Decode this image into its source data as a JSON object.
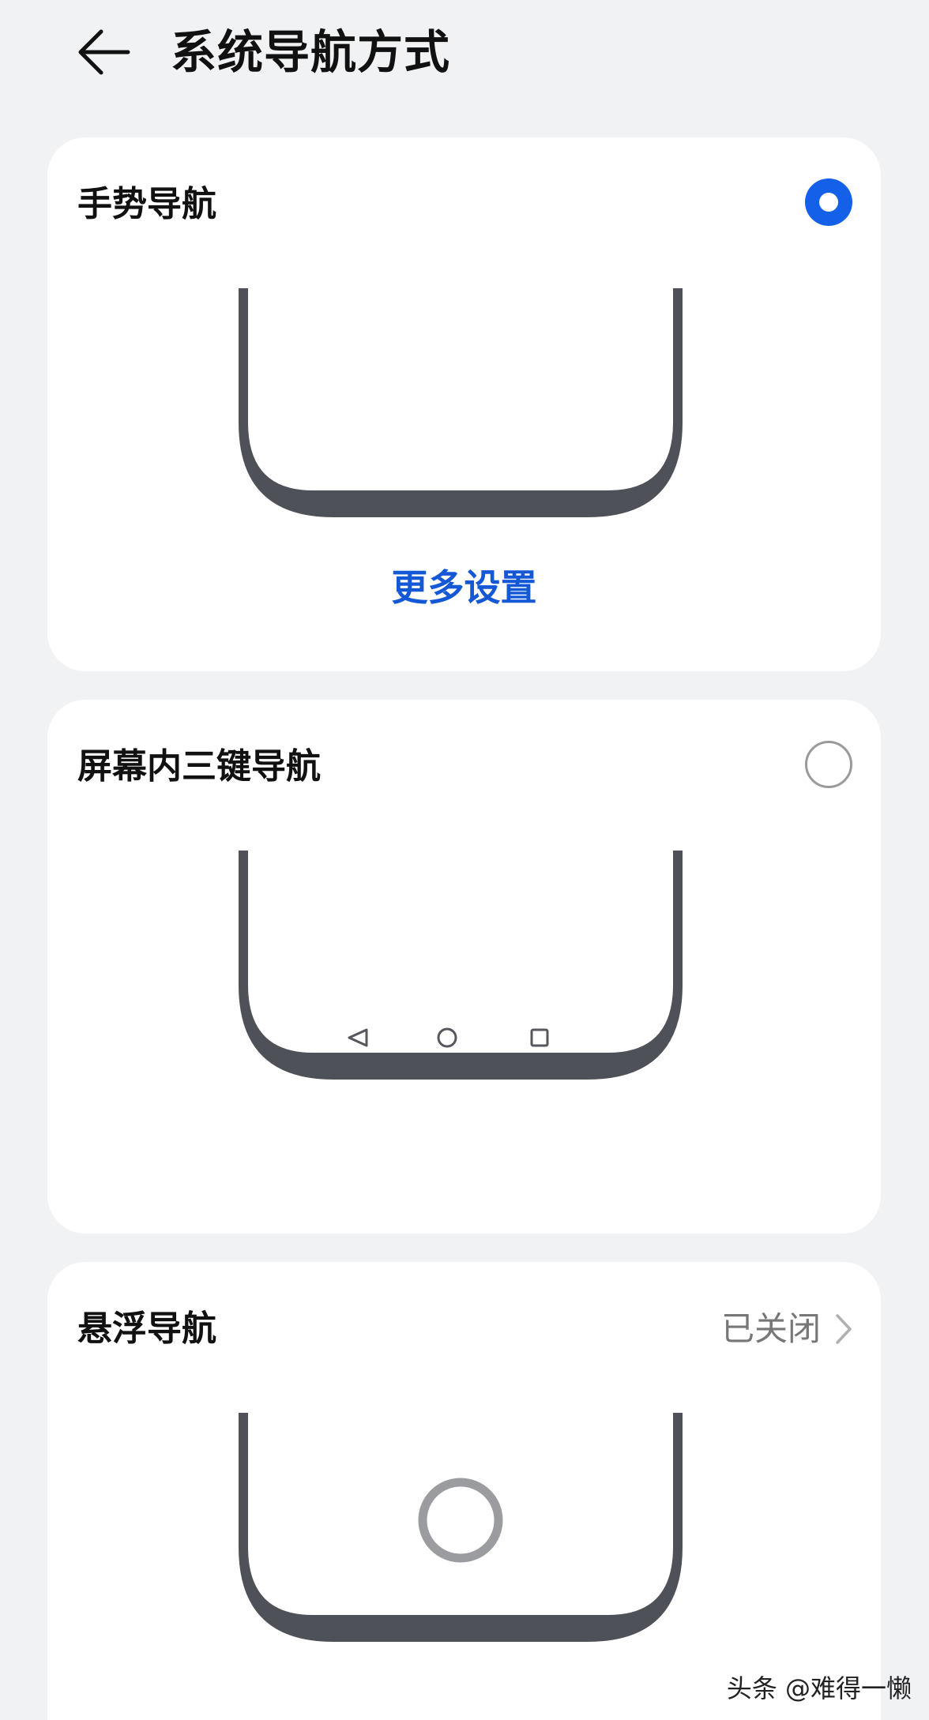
{
  "header": {
    "title": "系统导航方式",
    "back_icon": "arrow-left-icon"
  },
  "options": [
    {
      "title": "手势导航",
      "selected": true,
      "illustration": "phone-bottom-gesture",
      "link": "更多设置"
    },
    {
      "title": "屏幕内三键导航",
      "selected": false,
      "illustration": "phone-bottom-three-keys",
      "nav_icons": [
        "back-triangle-icon",
        "home-circle-icon",
        "recents-square-icon"
      ]
    },
    {
      "title": "悬浮导航",
      "status": "已关闭",
      "illustration": "phone-bottom-floating-dock",
      "chevron_icon": "chevron-right-icon"
    }
  ],
  "watermark": "头条 @难得一懒",
  "colors": {
    "accent": "#1560e8",
    "link": "#1458d6",
    "background": "#f1f2f4",
    "card": "#ffffff",
    "phone_frame": "#4f5158"
  }
}
